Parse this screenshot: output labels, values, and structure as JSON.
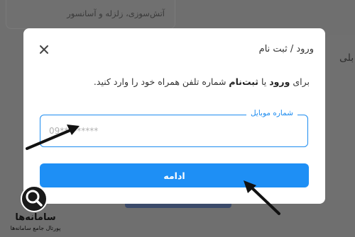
{
  "background": {
    "top_card_text": "آتش‌سوزی، زلزله و آسانسور",
    "right_card_text": "بلی"
  },
  "modal": {
    "title": "ورود / ثبت نام",
    "instruction_prefix": "برای ",
    "instruction_login": "ورود",
    "instruction_or": " یا ",
    "instruction_signup": "ثبت‌نام",
    "instruction_suffix": " شماره تلفن همراه خود را وارد کنید.",
    "phone_field": {
      "label": "شماره موبایل",
      "value": "",
      "placeholder": "09*********"
    },
    "continue_label": "ادامه"
  },
  "logo": {
    "name": "سامانه‌ها",
    "subtitle": "پورتال جامع سامانه‌ها"
  },
  "icons": {
    "close": "close-icon",
    "logo": "magnifier-logo-icon"
  },
  "colors": {
    "accent": "#1e8ff5",
    "overlay": "#6f6f6f"
  }
}
